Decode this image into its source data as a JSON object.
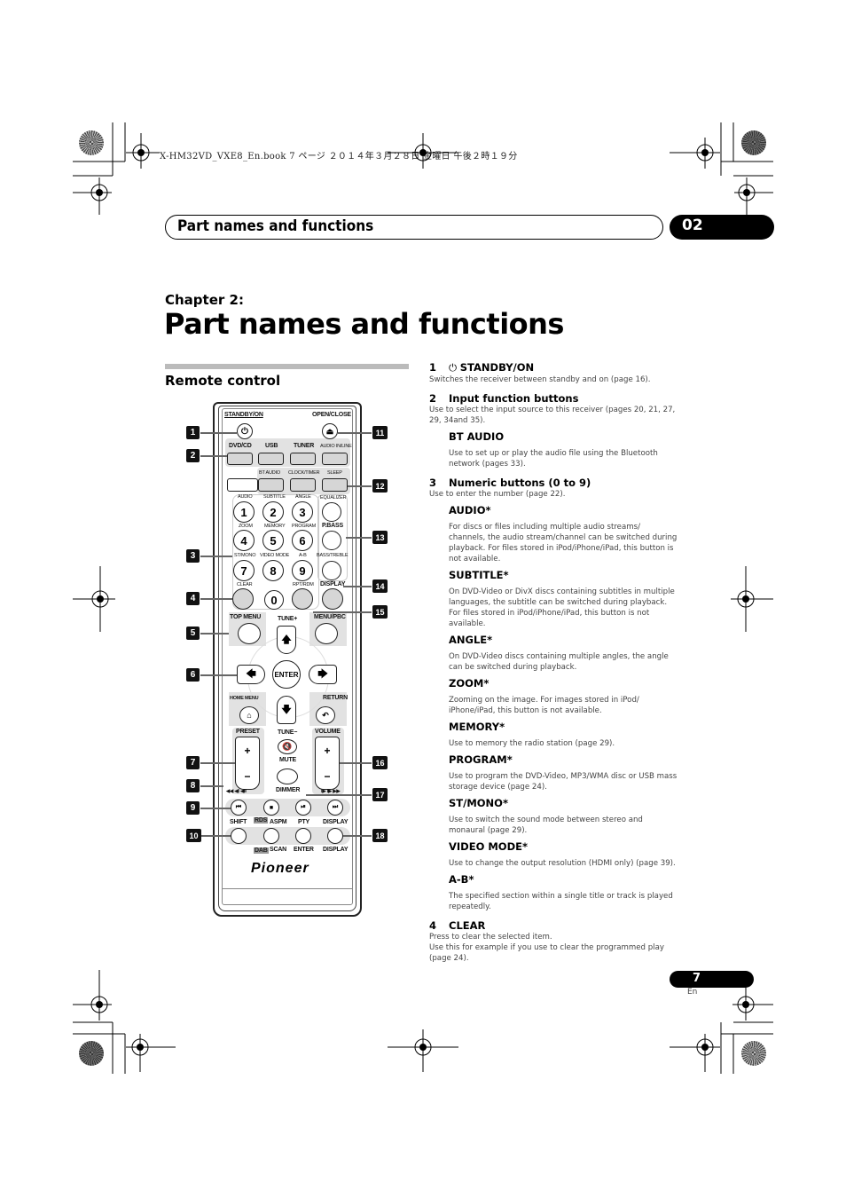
{
  "print_header": "X-HM32VD_VXE8_En.book  7 ページ  ２０１４年３月２８日  金曜日  午後２時１９分",
  "running_header": {
    "title": "Part names and functions",
    "chapter_number": "02"
  },
  "chapter_label": "Chapter 2:",
  "page_title": "Part names and functions",
  "section_title": "Remote control",
  "remote": {
    "labels": {
      "standby": "STANDBY/ON",
      "open_close": "OPEN/CLOSE",
      "dvd_cd": "DVD/CD",
      "usb": "USB",
      "tuner": "TUNER",
      "audio_in": "AUDIO IN/LINE",
      "bt_audio": "BT AUDIO",
      "clock_timer": "CLOCK/TIMER",
      "sleep": "SLEEP",
      "audio": "AUDIO",
      "subtitle": "SUBTITLE",
      "angle": "ANGLE",
      "equalizer": "EQUALIZER",
      "zoom": "ZOOM",
      "memory": "MEMORY",
      "program": "PROGRAM",
      "pbass": "P.BASS",
      "st_mono": "ST/MONO",
      "video_mode": "VIDEO MODE",
      "ab": "A-B",
      "bass_treble": "BASS/TREBLE",
      "clear": "CLEAR",
      "rpt_rdm": "RPT/RDM",
      "display": "DISPLAY",
      "top_menu": "TOP MENU",
      "tune_plus": "TUNE+",
      "menu_pbc": "MENU/PBC",
      "enter": "ENTER",
      "home_menu": "HOME MENU",
      "return": "RETURN",
      "preset": "PRESET",
      "tune_minus": "TUNE−",
      "volume": "VOLUME",
      "mute": "MUTE",
      "dimmer": "DIMMER",
      "shift": "SHIFT",
      "rds": "RDS",
      "aspm": "ASPM",
      "pty": "PTY",
      "display2": "DISPLAY",
      "dab": "DAB",
      "scan": "SCAN",
      "enter2": "ENTER",
      "display3": "DISPLAY",
      "plus": "+",
      "minus": "−",
      "brand": "Pioneer"
    },
    "digits": [
      "1",
      "2",
      "3",
      "4",
      "5",
      "6",
      "7",
      "8",
      "9",
      "0"
    ],
    "callouts": [
      "1",
      "2",
      "3",
      "4",
      "5",
      "6",
      "7",
      "8",
      "9",
      "10",
      "11",
      "12",
      "13",
      "14",
      "15",
      "16",
      "17",
      "18"
    ]
  },
  "items": [
    {
      "num": "1",
      "title": "STANDBY/ON",
      "icon": "power-icon",
      "desc": "Switches the receiver between standby and on (page 16)."
    },
    {
      "num": "2",
      "title": "Input function buttons",
      "desc": "Use to select the input source to this receiver (pages 20, 21, 27, 29, 34and 35).",
      "subs": [
        {
          "title": "BT AUDIO",
          "desc": "Use to set up or play the audio file using the Bluetooth network (pages 33)."
        }
      ]
    },
    {
      "num": "3",
      "title": "Numeric buttons (0 to 9)",
      "desc": "Use to enter the number (page 22).",
      "subs": [
        {
          "title": "AUDIO*",
          "desc": "For discs or files including multiple audio streams/ channels, the audio stream/channel can be switched during playback. For files stored in iPod/iPhone/iPad, this button is not available."
        },
        {
          "title": "SUBTITLE*",
          "desc": "On DVD-Video or DivX discs containing subtitles in multiple languages, the subtitle can be switched during playback. For files stored in iPod/iPhone/iPad, this button is not available."
        },
        {
          "title": "ANGLE*",
          "desc": "On DVD-Video discs containing multiple angles, the angle can be switched during playback."
        },
        {
          "title": "ZOOM*",
          "desc": "Zooming on the image. For images stored in iPod/ iPhone/iPad, this button is not available."
        },
        {
          "title": "MEMORY*",
          "desc": "Use to memory the radio station (page 29)."
        },
        {
          "title": "PROGRAM*",
          "desc": "Use to program the DVD-Video, MP3/WMA disc or USB mass storage device (page 24)."
        },
        {
          "title": "ST/MONO*",
          "desc": "Use to switch the sound mode between stereo and monaural (page 29)."
        },
        {
          "title": "VIDEO MODE*",
          "desc": "Use to change the output resolution (HDMI only) (page 39)."
        },
        {
          "title": "A-B*",
          "desc": "The specified section within a single title or track is played repeatedly."
        }
      ]
    },
    {
      "num": "4",
      "title": "CLEAR",
      "desc": "Press to clear the selected item.",
      "desc2": "Use this for example if you use to clear the programmed play (page 24)."
    }
  ],
  "page_number": "7",
  "page_lang": "En"
}
